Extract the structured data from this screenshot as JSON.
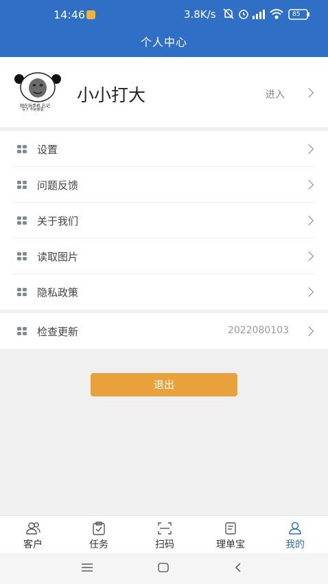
{
  "status_bar": {
    "time": "14:46",
    "net_speed": "3.8K/s",
    "battery": "85"
  },
  "header": {
    "title": "个人中心"
  },
  "profile": {
    "avatar_caption_line1": "刚在玩手机 忘记",
    "avatar_caption_line2": "写了 不好意思",
    "username": "小小打大",
    "enter_label": "进入"
  },
  "menu": {
    "items": [
      {
        "label": "设置"
      },
      {
        "label": "问题反馈"
      },
      {
        "label": "关于我们"
      },
      {
        "label": "读取图片"
      },
      {
        "label": "隐私政策"
      }
    ],
    "update": {
      "label": "检查更新",
      "version": "2022080103"
    }
  },
  "logout_label": "退出",
  "tabbar": {
    "tabs": [
      {
        "label": "客户",
        "icon": "customers-icon"
      },
      {
        "label": "任务",
        "icon": "task-icon"
      },
      {
        "label": "扫码",
        "icon": "scan-icon"
      },
      {
        "label": "理单宝",
        "icon": "document-icon"
      },
      {
        "label": "我的",
        "icon": "profile-icon",
        "active": true
      }
    ]
  },
  "colors": {
    "header": "#2f6fc5",
    "accent_button": "#e9a13c",
    "active_tab": "#2f6fc5"
  }
}
